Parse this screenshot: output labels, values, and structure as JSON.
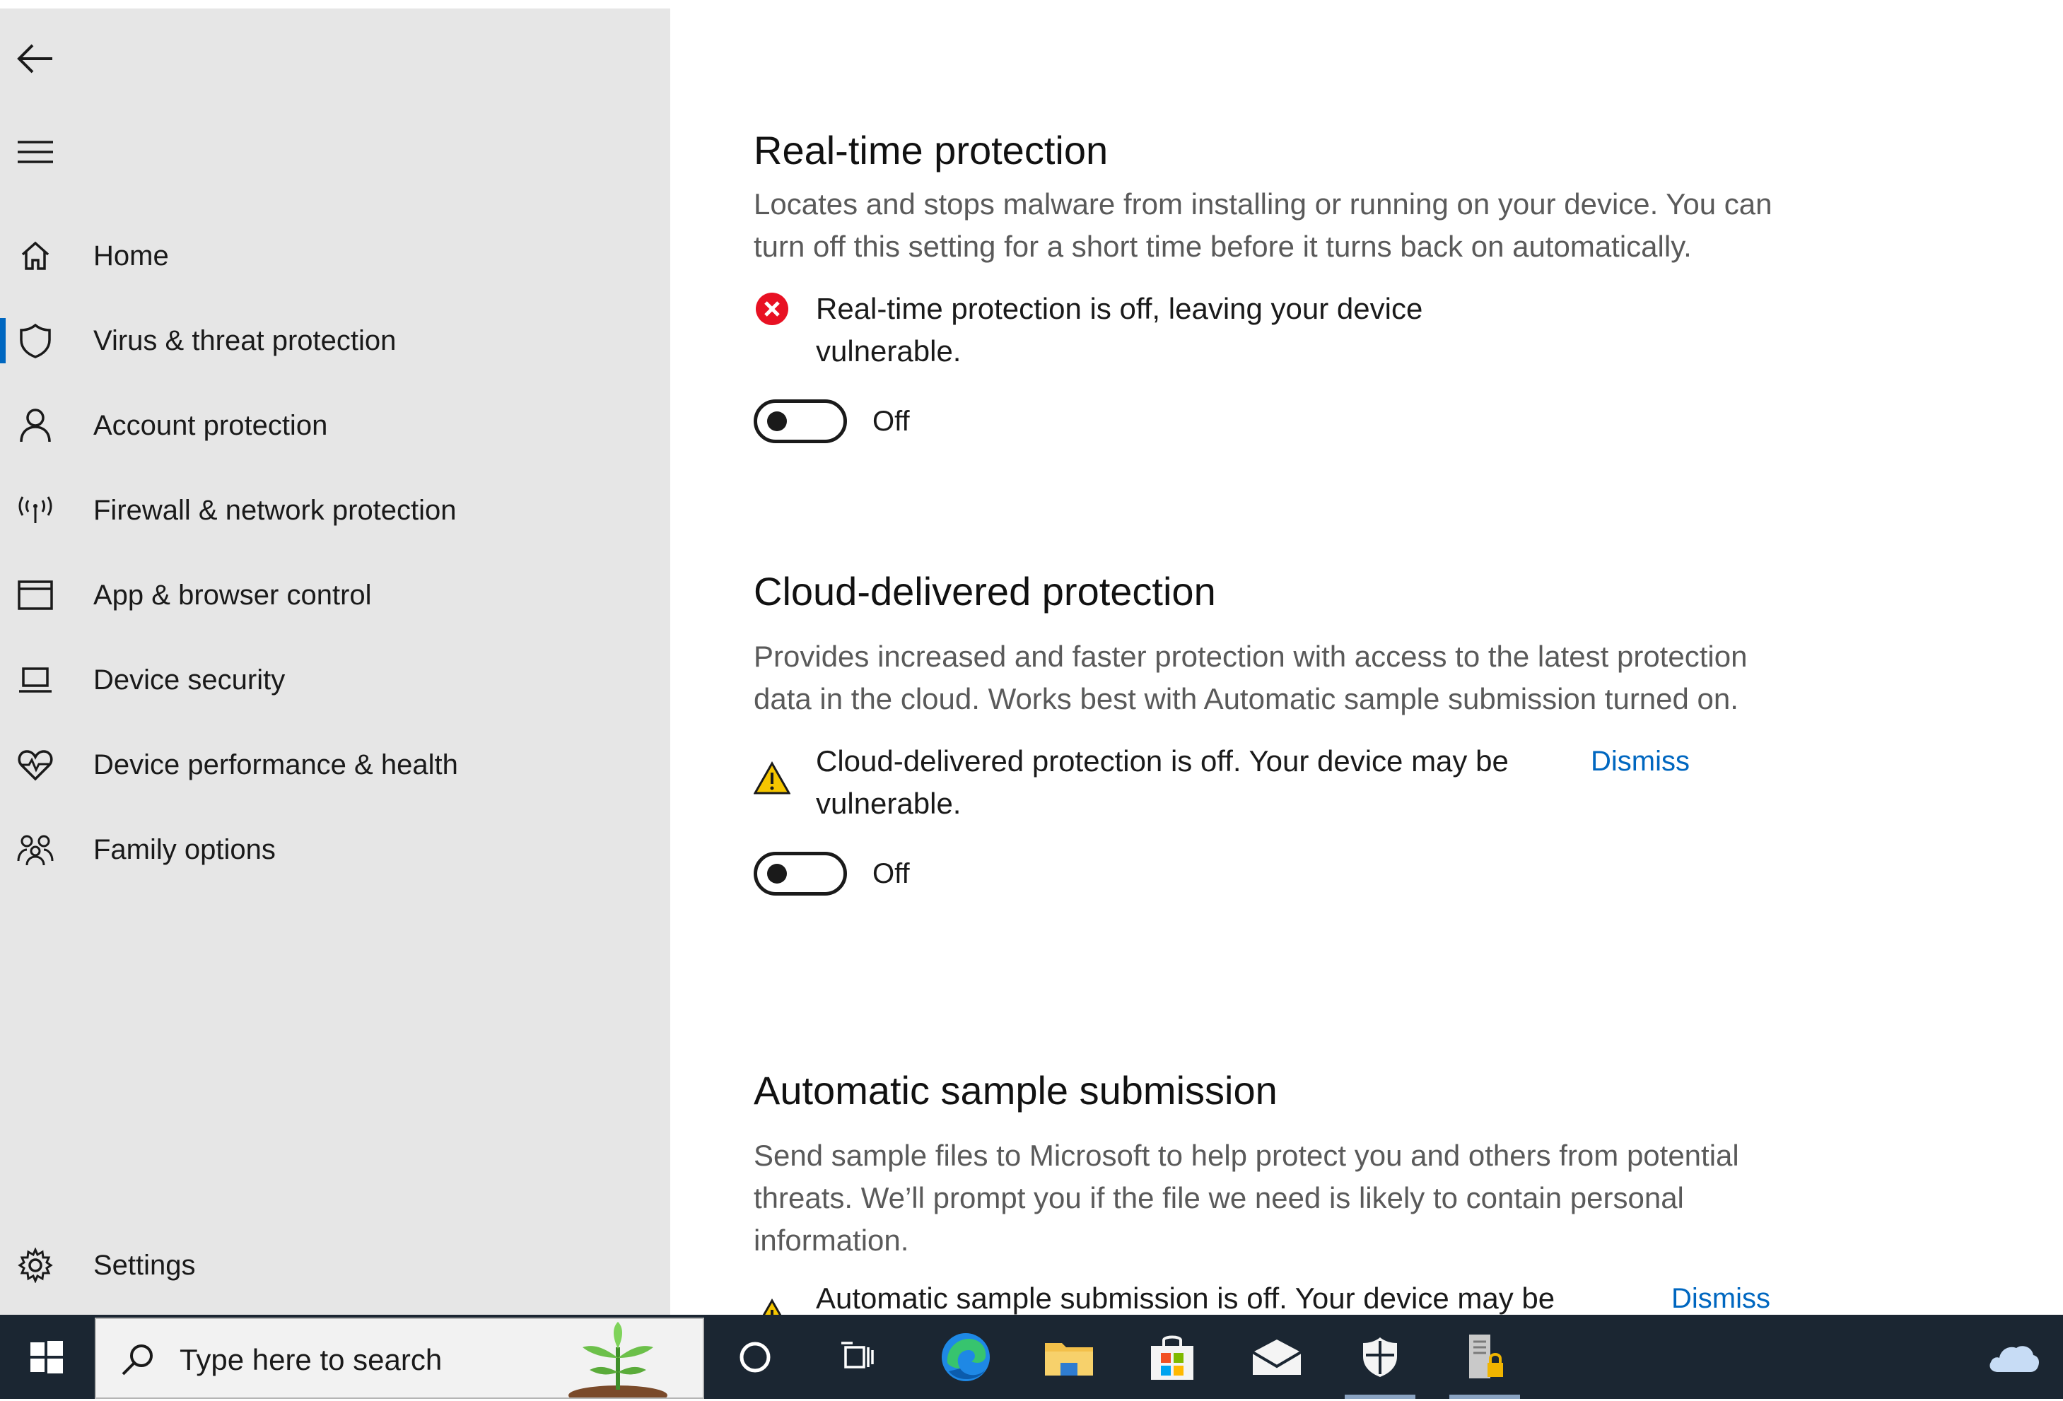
{
  "sidebar": {
    "items": [
      {
        "label": "Home",
        "icon": "home-icon"
      },
      {
        "label": "Virus & threat protection",
        "icon": "shield-icon",
        "active": true
      },
      {
        "label": "Account protection",
        "icon": "person-icon"
      },
      {
        "label": "Firewall & network protection",
        "icon": "wifi-antenna-icon"
      },
      {
        "label": "App & browser control",
        "icon": "browser-window-icon"
      },
      {
        "label": "Device security",
        "icon": "laptop-icon"
      },
      {
        "label": "Device performance & health",
        "icon": "heart-icon"
      },
      {
        "label": "Family options",
        "icon": "family-icon"
      }
    ],
    "settings_label": "Settings"
  },
  "sections": {
    "realtime": {
      "title": "Real-time protection",
      "description": "Locates and stops malware from installing or running on your device. You can turn off this setting for a short time before it turns back on automatically.",
      "status": "Real-time protection is off, leaving your device vulnerable.",
      "toggle_label": "Off"
    },
    "cloud": {
      "title": "Cloud-delivered protection",
      "description": "Provides increased and faster protection with access to the latest protection data in the cloud. Works best with Automatic sample submission turned on.",
      "status": "Cloud-delivered protection is off. Your device may be vulnerable.",
      "dismiss": "Dismiss",
      "toggle_label": "Off"
    },
    "sample": {
      "title": "Automatic sample submission",
      "description": "Send sample files to Microsoft to help protect you and others from potential threats. We’ll prompt you if the file we need is likely to contain personal information.",
      "status": "Automatic sample submission is off. Your device may be",
      "dismiss": "Dismiss"
    }
  },
  "taskbar": {
    "search_placeholder": "Type here to search"
  },
  "colors": {
    "accent": "#0067c0",
    "error": "#e81123",
    "warning": "#f6c600",
    "sidebar_bg": "#e6e6e6",
    "taskbar_bg": "#1b2632"
  }
}
